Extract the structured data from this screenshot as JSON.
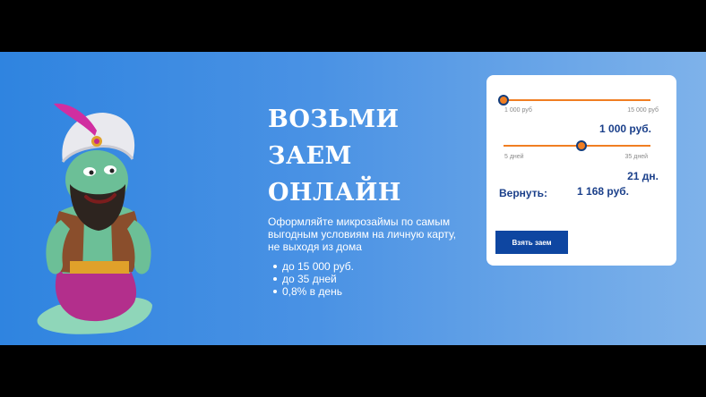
{
  "hero": {
    "headline_lines": [
      "ВОЗЬМИ",
      "ЗАЕМ",
      "ОНЛАЙН"
    ],
    "description": "Оформляйте микрозаймы по самым выгодным условиям на личную карту, не выходя из дома",
    "bullets": [
      "до 15 000 руб.",
      "до 35 дней",
      "0,8% в день"
    ]
  },
  "calculator": {
    "amount_slider": {
      "min_label": "1 000 руб",
      "max_label": "15 000 руб",
      "value_label": "1 000 руб.",
      "level": 0
    },
    "days_slider": {
      "min_label": "5 дней",
      "max_label": "35 дней",
      "value_label": "21 дн.",
      "level": 0.53
    },
    "repay_label": "Вернуть:",
    "repay_value": "1 168 руб.",
    "button_label": "Взять заем"
  },
  "colors": {
    "banner_start": "#2f84e0",
    "banner_end": "#7eb2ea",
    "slider_track": "#f07e22",
    "slider_thumb_border": "#133d7c",
    "accent_text": "#1a3f8a",
    "button": "#0e46a1"
  },
  "illustration": "genie-mascot"
}
